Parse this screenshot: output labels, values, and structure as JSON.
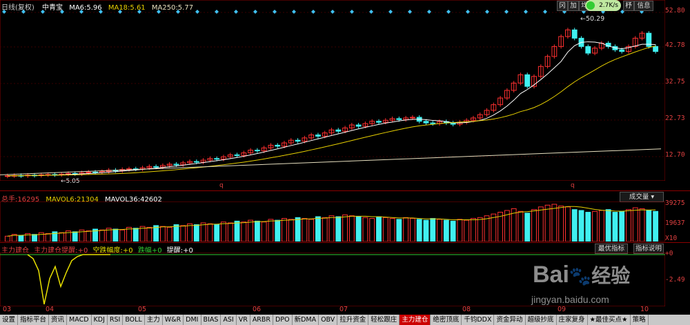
{
  "price_header": {
    "period": "日线(复权)",
    "stock": "中青宝",
    "ma6_label": "MA6:",
    "ma6_value": "5.96",
    "ma18_label": "MA18:",
    "ma18_value": "5.61",
    "ma250_label": "MA250:",
    "ma250_value": "5.77"
  },
  "price_axis": [
    "52.80",
    "42.78",
    "32.75",
    "22.73",
    "12.70"
  ],
  "price_labels": {
    "high": "50.29",
    "low": "5.05",
    "marker1": "q",
    "marker2": "q"
  },
  "top_buttons": [
    "冈",
    "加",
    "均",
    "",
    "",
    "",
    "杼",
    "信息"
  ],
  "badge": {
    "value": "2.7K/s"
  },
  "vol_header": {
    "total_label": "总手:",
    "total_value": "16295",
    "mavol6_label": "MAVOL6:",
    "mavol6_value": "21304",
    "mavol36_label": "MAVOL36:",
    "mavol36_value": "42602"
  },
  "vol_axis": [
    "39275",
    "19637",
    "X10"
  ],
  "vol_dropdown": "成交量",
  "ind_header": {
    "a": "主力建仓",
    "b": "主力建仓提醒:",
    "b_value": "+0",
    "c": "空跌幅度:",
    "c_value": "+0",
    "d": "跌幅",
    "d_value": "+0",
    "e": "提醒:",
    "e_value": "+0"
  },
  "ind_buttons": [
    "最优指标",
    "指标说明"
  ],
  "ind_axis": [
    "+0",
    "-2.49"
  ],
  "date_axis": [
    "03",
    "04",
    "05",
    "06",
    "07",
    "08",
    "09",
    "10"
  ],
  "tabs": [
    "设置",
    "指标平台",
    "资讯",
    "MACD",
    "KDJ",
    "RSI",
    "BOLL",
    "主力",
    "W&R",
    "DMI",
    "BIAS",
    "ASI",
    "VR",
    "ARBR",
    "DPO",
    "新DMA",
    "OBV",
    "拉升资金",
    "轻松跟庄",
    "主力建仓",
    "绝密顶底",
    "千钧DDX",
    "资金异动",
    "超级抄底",
    "庄家复身",
    "★最佳买点★",
    "策略"
  ],
  "active_tab": "主力建仓",
  "watermark": {
    "brand": "Bai",
    "brand2": "经验",
    "url": "jingyan.baidu.com"
  },
  "colors": {
    "up": "#ff3030",
    "down": "#40f0f0",
    "ma6": "#ffffff",
    "ma18": "#e8d000",
    "ma250": "#e8e0c0",
    "frame": "#8b0000",
    "indicator": "#e8e000"
  },
  "chart_data": {
    "type": "candlestick",
    "title": "",
    "ylim": [
      5.05,
      52.8
    ],
    "close": [
      5.1,
      5.2,
      5.1,
      5.3,
      5.2,
      5.4,
      5.5,
      5.4,
      5.6,
      5.8,
      5.7,
      6.0,
      6.2,
      6.1,
      6.4,
      6.8,
      6.6,
      7.0,
      7.2,
      7.1,
      7.5,
      7.9,
      7.7,
      8.2,
      8.6,
      8.4,
      9.0,
      9.4,
      9.2,
      9.8,
      10.3,
      10.1,
      10.8,
      11.4,
      11.2,
      12.0,
      12.8,
      12.6,
      13.5,
      14.3,
      14.0,
      15.0,
      15.8,
      15.5,
      16.5,
      17.4,
      17.0,
      18.0,
      18.9,
      18.5,
      19.5,
      20.4,
      20.0,
      20.8,
      21.5,
      21.2,
      21.8,
      22.3,
      22.0,
      22.5,
      22.7,
      21.5,
      21.0,
      20.8,
      21.4,
      21.0,
      20.6,
      21.2,
      21.8,
      22.5,
      23.5,
      24.8,
      26.5,
      28.5,
      30.8,
      33.0,
      35.5,
      32.0,
      35.0,
      38.0,
      41.0,
      44.0,
      47.0,
      49.0,
      46.5,
      44.0,
      42.0,
      43.5,
      45.0,
      44.0,
      43.0,
      42.5,
      44.0,
      46.5,
      48.0,
      44.0,
      42.5
    ],
    "open": [
      5.0,
      5.1,
      5.2,
      5.1,
      5.3,
      5.2,
      5.4,
      5.5,
      5.4,
      5.6,
      5.8,
      5.7,
      6.0,
      6.2,
      6.1,
      6.4,
      6.8,
      6.6,
      7.0,
      7.2,
      7.1,
      7.5,
      7.9,
      7.7,
      8.2,
      8.6,
      8.4,
      9.0,
      9.4,
      9.2,
      9.8,
      10.3,
      10.1,
      10.8,
      11.4,
      11.2,
      12.0,
      12.8,
      12.6,
      13.5,
      14.3,
      14.0,
      15.0,
      15.8,
      15.5,
      16.5,
      17.4,
      17.0,
      18.0,
      18.9,
      18.5,
      19.5,
      20.4,
      20.0,
      20.8,
      21.5,
      21.2,
      21.8,
      22.3,
      22.0,
      22.5,
      22.7,
      21.5,
      21.0,
      20.8,
      21.4,
      21.0,
      20.6,
      21.2,
      21.8,
      22.5,
      23.5,
      24.8,
      26.5,
      28.5,
      30.8,
      33.0,
      35.5,
      32.0,
      35.0,
      38.0,
      41.0,
      44.0,
      47.0,
      49.0,
      46.5,
      44.0,
      42.0,
      43.5,
      45.0,
      44.0,
      43.0,
      42.5,
      44.0,
      46.5,
      48.0,
      44.0
    ],
    "volume": [
      6,
      8,
      7,
      9,
      8,
      10,
      9,
      11,
      10,
      12,
      11,
      13,
      12,
      14,
      13,
      15,
      14,
      13,
      16,
      15,
      17,
      16,
      18,
      17,
      16,
      19,
      18,
      20,
      19,
      21,
      20,
      19,
      22,
      21,
      23,
      22,
      24,
      23,
      22,
      25,
      24,
      26,
      25,
      27,
      26,
      25,
      28,
      27,
      29,
      28,
      30,
      29,
      28,
      27,
      26,
      28,
      27,
      26,
      25,
      27,
      26,
      25,
      24,
      26,
      25,
      24,
      23,
      25,
      24,
      26,
      27,
      29,
      31,
      33,
      35,
      37,
      34,
      32,
      36,
      39,
      41,
      42,
      40,
      39,
      36,
      35,
      33,
      34,
      35,
      36,
      33,
      34,
      36,
      38,
      37,
      35,
      34
    ],
    "volume_axis": [
      19637,
      39275
    ],
    "indicator": [
      0,
      -0.2,
      -0.8,
      -2.49,
      -1.2,
      -0.6,
      -1.6,
      -0.9,
      -0.3,
      -0.1,
      0,
      0,
      0,
      0,
      0,
      0
    ],
    "indicator_axis": [
      -2.49,
      0
    ],
    "x_ticks": [
      "03",
      "04",
      "05",
      "06",
      "07",
      "08",
      "09",
      "10"
    ]
  }
}
